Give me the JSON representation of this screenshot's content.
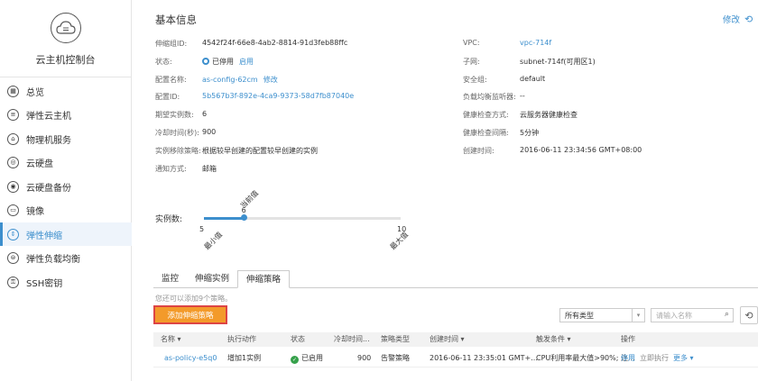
{
  "sidebar": {
    "title": "云主机控制台",
    "items": [
      {
        "label": "总览",
        "icon": "overview-icon"
      },
      {
        "label": "弹性云主机",
        "icon": "server-icon"
      },
      {
        "label": "物理机服务",
        "icon": "physical-machine-icon"
      },
      {
        "label": "云硬盘",
        "icon": "disk-icon"
      },
      {
        "label": "云硬盘备份",
        "icon": "disk-backup-icon"
      },
      {
        "label": "镜像",
        "icon": "image-icon"
      },
      {
        "label": "弹性伸缩",
        "icon": "auto-scaling-icon",
        "active": true
      },
      {
        "label": "弹性负载均衡",
        "icon": "load-balancer-icon"
      },
      {
        "label": "SSH密钥",
        "icon": "ssh-key-icon"
      }
    ]
  },
  "header": {
    "title": "基本信息",
    "edit_label": "修改"
  },
  "info_left": [
    {
      "key": "伸缩组ID:",
      "value": "4542f24f-66e8-4ab2-8814-91d3feb88ffc"
    },
    {
      "key": "状态:",
      "value": "已停用",
      "action": "启用"
    },
    {
      "key": "配置名称:",
      "value": "as-config-62cm",
      "action": "修改"
    },
    {
      "key": "配置ID:",
      "value": "5b567b3f-892e-4ca9-9373-58d7fb87040e"
    },
    {
      "key": "期望实例数:",
      "value": "6"
    },
    {
      "key": "冷却时间(秒):",
      "value": "900"
    },
    {
      "key": "实例移除策略:",
      "value": "根据较早创建的配置较早创建的实例"
    },
    {
      "key": "通知方式:",
      "value": "邮箱"
    }
  ],
  "info_right": [
    {
      "key": "VPC:",
      "value": "vpc-714f"
    },
    {
      "key": "子网:",
      "value": "subnet-714f(可用区1)"
    },
    {
      "key": "安全组:",
      "value": "default"
    },
    {
      "key": "负载均衡监听器:",
      "value": "--"
    },
    {
      "key": "健康检查方式:",
      "value": "云服务器健康检查"
    },
    {
      "key": "健康检查间隔:",
      "value": "5分钟"
    },
    {
      "key": "创建时间:",
      "value": "2016-06-11 23:34:56 GMT+08:00"
    }
  ],
  "slider": {
    "label": "实例数:",
    "min": "5",
    "current": "6",
    "max": "10",
    "min_label": "最小值",
    "current_label": "当前值",
    "max_label": "最大值",
    "min_value": 5,
    "max_value": 10,
    "current_value": 6
  },
  "tabs": [
    {
      "label": "监控"
    },
    {
      "label": "伸缩实例"
    },
    {
      "label": "伸缩策略",
      "active": true
    }
  ],
  "hint": "您还可以添加9个策略。",
  "add_button": "添加伸缩策略",
  "type_select": "所有类型",
  "search_placeholder": "请输入名称",
  "table": {
    "headers": [
      "名称 ▾",
      "执行动作",
      "状态",
      "冷却时间...",
      "策略类型",
      "创建时间 ▾",
      "触发条件 ▾",
      "操作"
    ],
    "rows": [
      {
        "name": "as-policy-e5q0",
        "action": "增加1实例",
        "status": "已启用",
        "cooldown": "900",
        "type": "告警策略",
        "created": "2016-06-11 23:35:01 GMT+...",
        "condition": "CPU利用率最大值>90%; 连...",
        "ops": [
          "停用",
          "立即执行",
          "更多 ▾"
        ]
      }
    ]
  },
  "colors": {
    "accent": "#3d8fcd",
    "button_orange": "#f39a2a",
    "status_green": "#36a14b"
  }
}
